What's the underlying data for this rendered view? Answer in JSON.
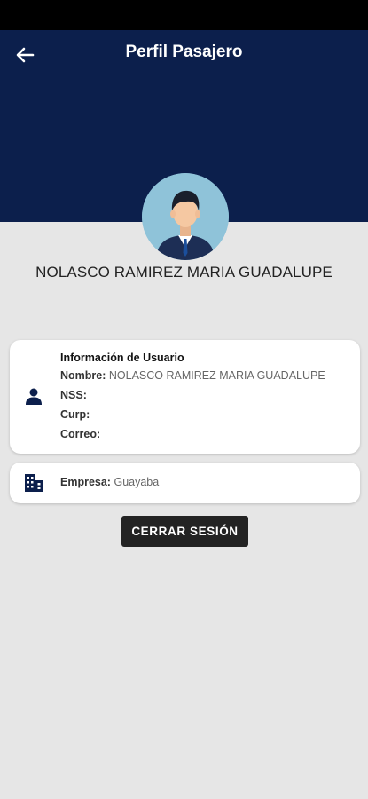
{
  "header": {
    "title": "Perfil Pasajero",
    "back_icon": "arrow-left-icon",
    "background_color": "#0c1f4c"
  },
  "profile": {
    "name": "NOLASCO RAMIREZ MARIA GUADALUPE",
    "avatar_icon": "user-avatar"
  },
  "user_info": {
    "title": "Información de Usuario",
    "icon": "person-icon",
    "fields": [
      {
        "label": "Nombre:",
        "value": "NOLASCO RAMIREZ MARIA GUADALUPE"
      },
      {
        "label": "NSS:",
        "value": ""
      },
      {
        "label": "Curp:",
        "value": ""
      },
      {
        "label": "Correo:",
        "value": ""
      }
    ]
  },
  "company": {
    "icon": "building-icon",
    "label": "Empresa:",
    "value": "Guayaba"
  },
  "logout": {
    "label": "CERRAR SESIÓN"
  }
}
